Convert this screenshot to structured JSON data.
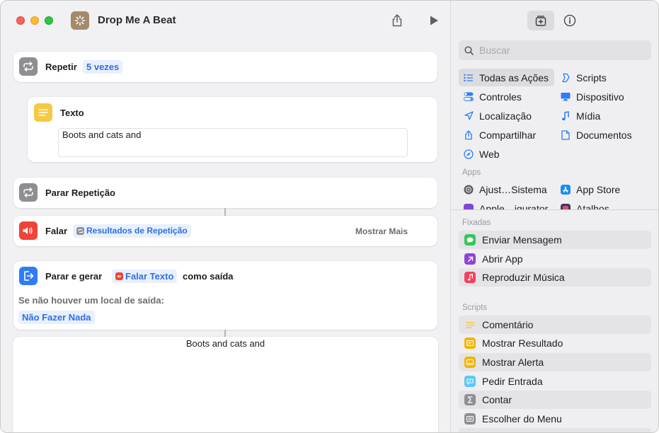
{
  "window": {
    "title": "Drop Me A Beat"
  },
  "actions": {
    "repeat": {
      "label": "Repetir",
      "count": "5 vezes"
    },
    "text": {
      "label": "Texto",
      "value": "Boots and cats and"
    },
    "stop_repeat": {
      "label": "Parar Repetição"
    },
    "speak": {
      "label": "Falar",
      "token": "Resultados de Repetição",
      "show_more": "Mostrar Mais"
    },
    "stop_output": {
      "label": "Parar e gerar",
      "token": "Falar Texto",
      "suffix": "como saída",
      "fallback_label": "Se não houver um local de saída:",
      "fallback_value": "Não Fazer Nada"
    },
    "result": {
      "text": "Boots and cats and"
    }
  },
  "sidebar": {
    "search": {
      "placeholder": "Buscar"
    },
    "categories": [
      {
        "label": "Todas as Ações",
        "icon": "list-icon",
        "selected": true
      },
      {
        "label": "Scripts",
        "icon": "scripts-icon"
      },
      {
        "label": "Controles",
        "icon": "toggles-icon"
      },
      {
        "label": "Dispositivo",
        "icon": "display-icon"
      },
      {
        "label": "Localização",
        "icon": "location-icon"
      },
      {
        "label": "Mídia",
        "icon": "music-note-icon"
      },
      {
        "label": "Compartilhar",
        "icon": "share-icon"
      },
      {
        "label": "Documentos",
        "icon": "document-icon"
      },
      {
        "label": "Web",
        "icon": "compass-icon"
      }
    ],
    "apps_header": "Apps",
    "apps": [
      {
        "label": "Ajust…Sistema",
        "icon": "gear-icon"
      },
      {
        "label": "App Store",
        "icon": "app-store-icon"
      },
      {
        "label": "Apple…igurator",
        "icon": "configurator-icon"
      },
      {
        "label": "Atalhos",
        "icon": "shortcuts-icon"
      }
    ],
    "pinned_header": "Fixadas",
    "pinned": [
      {
        "label": "Enviar Mensagem",
        "icon": "message-icon",
        "color": "#34c759"
      },
      {
        "label": "Abrir App",
        "icon": "open-app-icon",
        "color": "#8e44d9"
      },
      {
        "label": "Reproduzir Música",
        "icon": "music-icon",
        "color": "#fa3e5c"
      }
    ],
    "scripts_header": "Scripts",
    "scripts": [
      {
        "label": "Comentário",
        "icon": "comment-icon",
        "color": "#f7c843"
      },
      {
        "label": "Mostrar Resultado",
        "icon": "show-result-icon",
        "color": "#f5b400"
      },
      {
        "label": "Mostrar Alerta",
        "icon": "alert-icon",
        "color": "#f5b400"
      },
      {
        "label": "Pedir Entrada",
        "icon": "ask-input-icon",
        "color": "#5ac8fa"
      },
      {
        "label": "Contar",
        "icon": "sigma-icon",
        "color": "#8e8e93"
      },
      {
        "label": "Escolher do Menu",
        "icon": "menu-icon",
        "color": "#8e8e93"
      }
    ]
  }
}
